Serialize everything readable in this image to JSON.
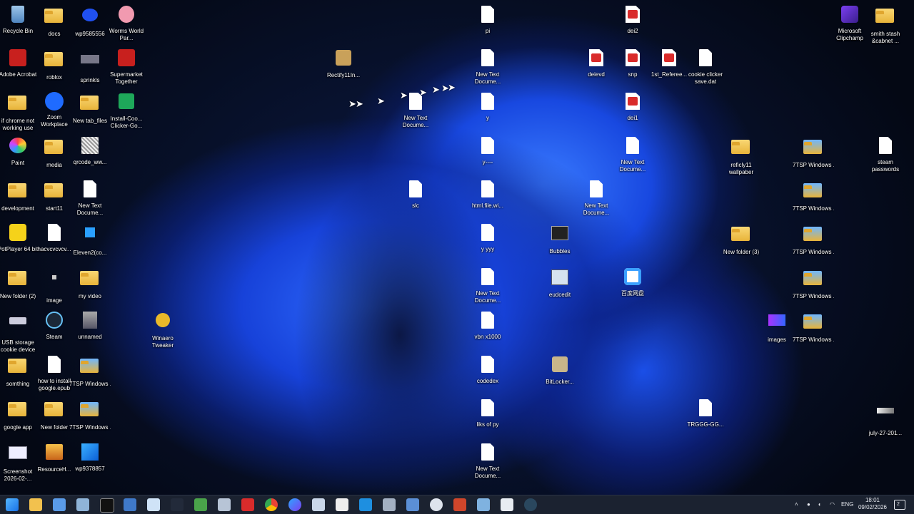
{
  "desktop": {
    "icons": [
      {
        "label": "Recycle Bin",
        "kind": "recycle"
      },
      {
        "label": "docs",
        "kind": "folder"
      },
      {
        "label": "wp9585556",
        "kind": "image"
      },
      {
        "label": "Worms World Par...",
        "kind": "app"
      },
      {
        "label": "Adobe Acrobat",
        "kind": "acrobat"
      },
      {
        "label": "roblox",
        "kind": "folder"
      },
      {
        "label": "sprinkls",
        "kind": "image"
      },
      {
        "label": "Supermarket Together",
        "kind": "app"
      },
      {
        "label": "if chrome not working use",
        "kind": "folder"
      },
      {
        "label": "Zoom Workplace",
        "kind": "zoom"
      },
      {
        "label": "New tab_files",
        "kind": "folder"
      },
      {
        "label": "Install-Coo... Clicker-Go...",
        "kind": "app"
      },
      {
        "label": "Paint",
        "kind": "app"
      },
      {
        "label": "media",
        "kind": "folder"
      },
      {
        "label": "qrcode_ww...",
        "kind": "image"
      },
      {
        "label": "development",
        "kind": "folder"
      },
      {
        "label": "start11",
        "kind": "folder"
      },
      {
        "label": "New Text Docume...",
        "kind": "doc"
      },
      {
        "label": "PotPlayer 64 bit",
        "kind": "app"
      },
      {
        "label": "hacvcvcvcv...",
        "kind": "doc"
      },
      {
        "label": "Eleven2(co...",
        "kind": "app"
      },
      {
        "label": "New folder (2)",
        "kind": "folder"
      },
      {
        "label": "image",
        "kind": "image"
      },
      {
        "label": "my video",
        "kind": "folder"
      },
      {
        "label": "USB storage cookie device",
        "kind": "app"
      },
      {
        "label": "Steam",
        "kind": "steam"
      },
      {
        "label": "unnamed",
        "kind": "image"
      },
      {
        "label": "somthing",
        "kind": "folder"
      },
      {
        "label": "how to install google.epub",
        "kind": "doc"
      },
      {
        "label": "7TSP Windows ...",
        "kind": "folder"
      },
      {
        "label": "google app",
        "kind": "folder"
      },
      {
        "label": "New folder",
        "kind": "folder"
      },
      {
        "label": "7TSP Windows ...",
        "kind": "folder"
      },
      {
        "label": "Screenshot 2026-02-...",
        "kind": "image"
      },
      {
        "label": "ResourceH...",
        "kind": "app"
      },
      {
        "label": "wp9378857",
        "kind": "win"
      },
      {
        "label": "Winaero Tweaker",
        "kind": "app"
      },
      {
        "label": "Rectify11In...",
        "kind": "app"
      },
      {
        "label": "New Text Docume...",
        "kind": "doc"
      },
      {
        "label": "slc",
        "kind": "doc"
      },
      {
        "label": "pi",
        "kind": "doc"
      },
      {
        "label": "New Text Docume...",
        "kind": "doc"
      },
      {
        "label": "y",
        "kind": "doc"
      },
      {
        "label": "y----",
        "kind": "doc"
      },
      {
        "label": "html.file.wi...",
        "kind": "doc"
      },
      {
        "label": "y yyy",
        "kind": "doc"
      },
      {
        "label": "New Text Docume...",
        "kind": "doc"
      },
      {
        "label": "vbn x1000",
        "kind": "doc"
      },
      {
        "label": "codedex",
        "kind": "doc"
      },
      {
        "label": "liks of py",
        "kind": "doc"
      },
      {
        "label": "New Text Docume...",
        "kind": "doc"
      },
      {
        "label": "Bubbles",
        "kind": "app"
      },
      {
        "label": "eudcedit",
        "kind": "app"
      },
      {
        "label": "BitLocker...",
        "kind": "app"
      },
      {
        "label": "deievd",
        "kind": "pdf"
      },
      {
        "label": "New Text Docume...",
        "kind": "doc"
      },
      {
        "label": "dei2",
        "kind": "pdf"
      },
      {
        "label": "snp",
        "kind": "pdf"
      },
      {
        "label": "dei1",
        "kind": "pdf"
      },
      {
        "label": "New Text Docume...",
        "kind": "doc"
      },
      {
        "label": "百度网盘",
        "kind": "app"
      },
      {
        "label": "1st_Referee...",
        "kind": "pdf"
      },
      {
        "label": "cookie clicker save.dat",
        "kind": "doc"
      },
      {
        "label": "TRGGG-GG...",
        "kind": "doc"
      },
      {
        "label": "reficly11 wallpaber",
        "kind": "folder"
      },
      {
        "label": "New folder (3)",
        "kind": "folder"
      },
      {
        "label": "images",
        "kind": "image"
      },
      {
        "label": "7TSP Windows ...",
        "kind": "folder"
      },
      {
        "label": "7TSP Windows ...",
        "kind": "folder"
      },
      {
        "label": "7TSP Windows ...",
        "kind": "folder"
      },
      {
        "label": "7TSP Windows ...",
        "kind": "folder"
      },
      {
        "label": "7TSP Windows ...",
        "kind": "folder"
      },
      {
        "label": "Microsoft Clipchamp",
        "kind": "app"
      },
      {
        "label": "smith stash &cabnet ...",
        "kind": "folder"
      },
      {
        "label": "steam passwords",
        "kind": "doc"
      },
      {
        "label": "july-27-201...",
        "kind": "image"
      }
    ]
  },
  "taskbar": {
    "apps": [
      "start",
      "explorer",
      "computer",
      "network",
      "terminal",
      "monitor",
      "notepad",
      "app",
      "gallery",
      "files",
      "acrobat",
      "chrome",
      "copilot",
      "zoom",
      "notes",
      "vscode",
      "phone",
      "store",
      "settings",
      "powerpoint",
      "photos",
      "security",
      "steam"
    ],
    "tray": {
      "lang": "ENG",
      "time": "18:01",
      "date": "09/02/2026",
      "notifications": "2"
    }
  }
}
